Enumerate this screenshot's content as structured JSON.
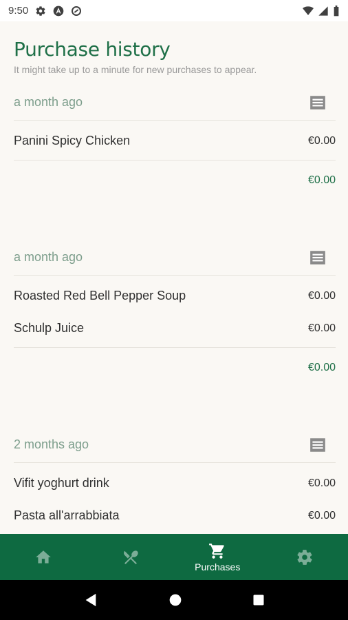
{
  "status_bar": {
    "time": "9:50",
    "icons": [
      "gear-icon",
      "app-a-icon",
      "app-circle-icon",
      "wifi-icon",
      "signal-icon",
      "battery-icon"
    ]
  },
  "page": {
    "title": "Purchase history",
    "subtitle": "It might take up to a minute for new purchases to appear."
  },
  "purchases": [
    {
      "date": "a month ago",
      "items": [
        {
          "name": "Panini Spicy Chicken",
          "price": "€0.00"
        }
      ],
      "total": "€0.00"
    },
    {
      "date": "a month ago",
      "items": [
        {
          "name": "Roasted Red Bell Pepper Soup",
          "price": "€0.00"
        },
        {
          "name": "Schulp Juice",
          "price": "€0.00"
        }
      ],
      "total": "€0.00"
    },
    {
      "date": "2 months ago",
      "items": [
        {
          "name": "Vifit yoghurt drink",
          "price": "€0.00"
        },
        {
          "name": "Pasta all'arrabbiata",
          "price": "€0.00"
        }
      ],
      "total": ""
    }
  ],
  "bottom_nav": {
    "items": [
      {
        "icon": "home-icon",
        "label": ""
      },
      {
        "icon": "cutlery-icon",
        "label": ""
      },
      {
        "icon": "cart-icon",
        "label": "Purchases"
      },
      {
        "icon": "settings-icon",
        "label": ""
      }
    ],
    "active_index": 2
  },
  "colors": {
    "accent": "#1f7048",
    "nav_bg": "#0e6a41",
    "date_text": "#7d9e8c",
    "background": "#faf8f4"
  }
}
